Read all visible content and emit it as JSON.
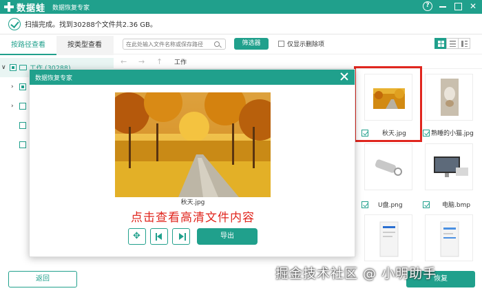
{
  "titlebar": {
    "app_name": "数据蛙",
    "subtitle": "数据恢复专家"
  },
  "status": {
    "text": "扫描完成。找到30288个文件共2.36 GB。"
  },
  "tabs": [
    {
      "label": "按路径查看",
      "active": true
    },
    {
      "label": "按类型查看",
      "active": false
    }
  ],
  "tree": {
    "root_label": "工作 (30288)"
  },
  "toolbar": {
    "search_placeholder": "在此处输入文件名称或保存路径",
    "filter_label": "筛选器",
    "only_deleted_label": "仅显示删除项"
  },
  "pathbar": {
    "path": "工作"
  },
  "thumbnails": [
    {
      "name": "秋天.jpg",
      "checked": true
    },
    {
      "name": "熟睡的小猫.jpg",
      "checked": true
    },
    {
      "name": "U盘.png",
      "checked": true
    },
    {
      "name": "电脑.bmp",
      "checked": true
    }
  ],
  "bottom": {
    "back_label": "返回",
    "recover_label": "恢复"
  },
  "modal": {
    "title": "数据恢复专家",
    "file_name": "秋天.jpg",
    "tip": "点击查看高清文件内容",
    "export_label": "导出"
  },
  "watermark": "掘金技术社区 @ 小明助手",
  "colors": {
    "accent": "#20a08c",
    "highlight": "#e0261e"
  }
}
